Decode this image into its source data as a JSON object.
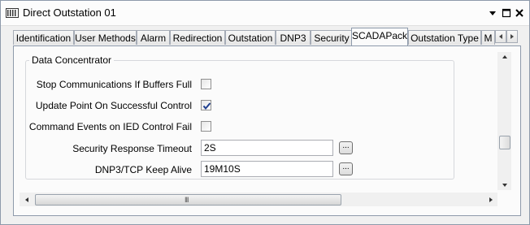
{
  "window": {
    "title": "Direct Outstation 01",
    "icons": [
      "outstation-icon",
      "dropdown-arrow-icon",
      "maximize-icon",
      "close-icon"
    ]
  },
  "tabs": [
    {
      "label": "Identification"
    },
    {
      "label": "User Methods"
    },
    {
      "label": "Alarm"
    },
    {
      "label": "Redirection"
    },
    {
      "label": "Outstation"
    },
    {
      "label": "DNP3"
    },
    {
      "label": "Security"
    },
    {
      "label": "SCADAPack",
      "active": true
    },
    {
      "label": "Outstation Type"
    },
    {
      "label": "M"
    }
  ],
  "group": {
    "title": "Data Concentrator",
    "checkboxes": [
      {
        "label": "Stop Communications If Buffers Full",
        "checked": false
      },
      {
        "label": "Update Point On Successful Control",
        "checked": true
      },
      {
        "label": "Command Events on IED Control Fail",
        "checked": false
      }
    ],
    "fields": [
      {
        "label": "Security Response Timeout",
        "value": "2S",
        "button": "..."
      },
      {
        "label": "DNP3/TCP Keep Alive",
        "value": "19M10S",
        "button": "..."
      }
    ]
  },
  "scrollbars": {
    "grip": "III"
  }
}
